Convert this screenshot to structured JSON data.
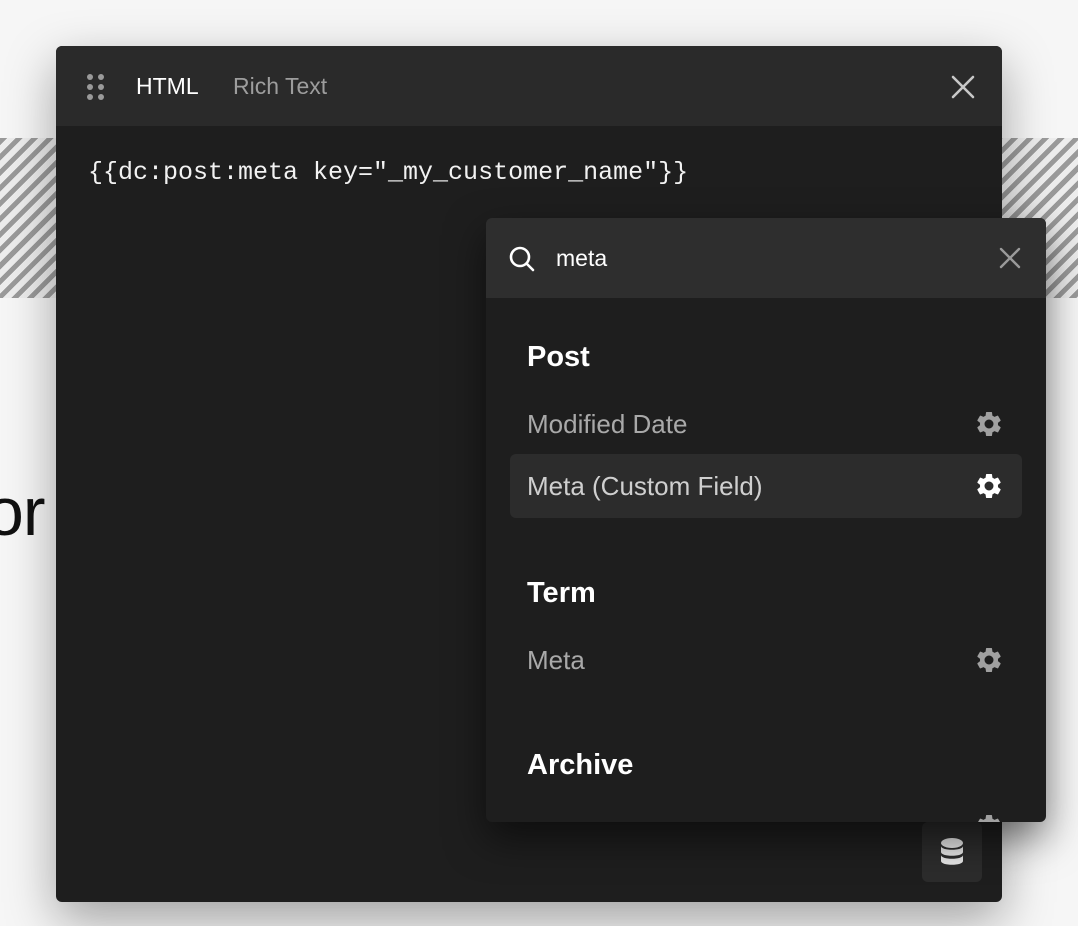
{
  "editor": {
    "tabs": [
      {
        "label": "HTML",
        "active": true
      },
      {
        "label": "Rich Text",
        "active": false
      }
    ],
    "code": "{{dc:post:meta key=\"_my_customer_name\"}}"
  },
  "dynamic_data": {
    "search": {
      "value": "meta"
    },
    "groups": [
      {
        "title": "Post",
        "items": [
          {
            "label": "Modified Date",
            "icon": "gear-icon"
          },
          {
            "label": "Meta (Custom Field)",
            "icon": "gear-icon",
            "highlighted": true
          }
        ]
      },
      {
        "title": "Term",
        "items": [
          {
            "label": "Meta",
            "icon": "gear-icon"
          }
        ]
      },
      {
        "title": "Archive",
        "items": []
      }
    ]
  },
  "background": {
    "partial_text": "or"
  },
  "colors": {
    "panel": "#1e1e1e",
    "header": "#2a2a2a",
    "highlight": "#2c2c2c"
  }
}
